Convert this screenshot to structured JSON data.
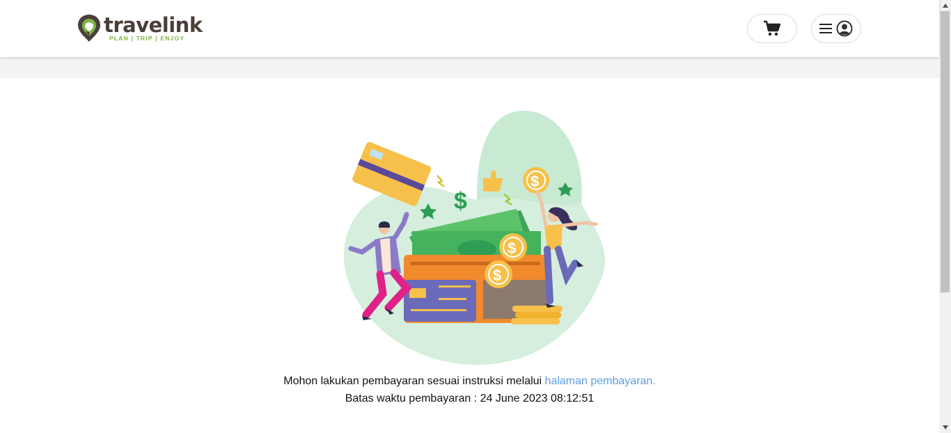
{
  "header": {
    "brand": "travelink",
    "tagline": "PLAN | TRIP | ENJOY"
  },
  "icons": {
    "cart": "cart-icon",
    "menu": "hamburger-icon",
    "user": "user-circle-icon"
  },
  "colors": {
    "brand_green": "#7cb342",
    "link": "#5c9ee0",
    "illustration_green": "#2e9e55"
  },
  "message": {
    "instruction_prefix": "Mohon lakukan pembayaran sesuai instruksi melalui",
    "instruction_link": "halaman pembayaran.",
    "deadline_label": "Batas waktu pembayaran :",
    "deadline_value": "24 June 2023 08:12:51"
  }
}
